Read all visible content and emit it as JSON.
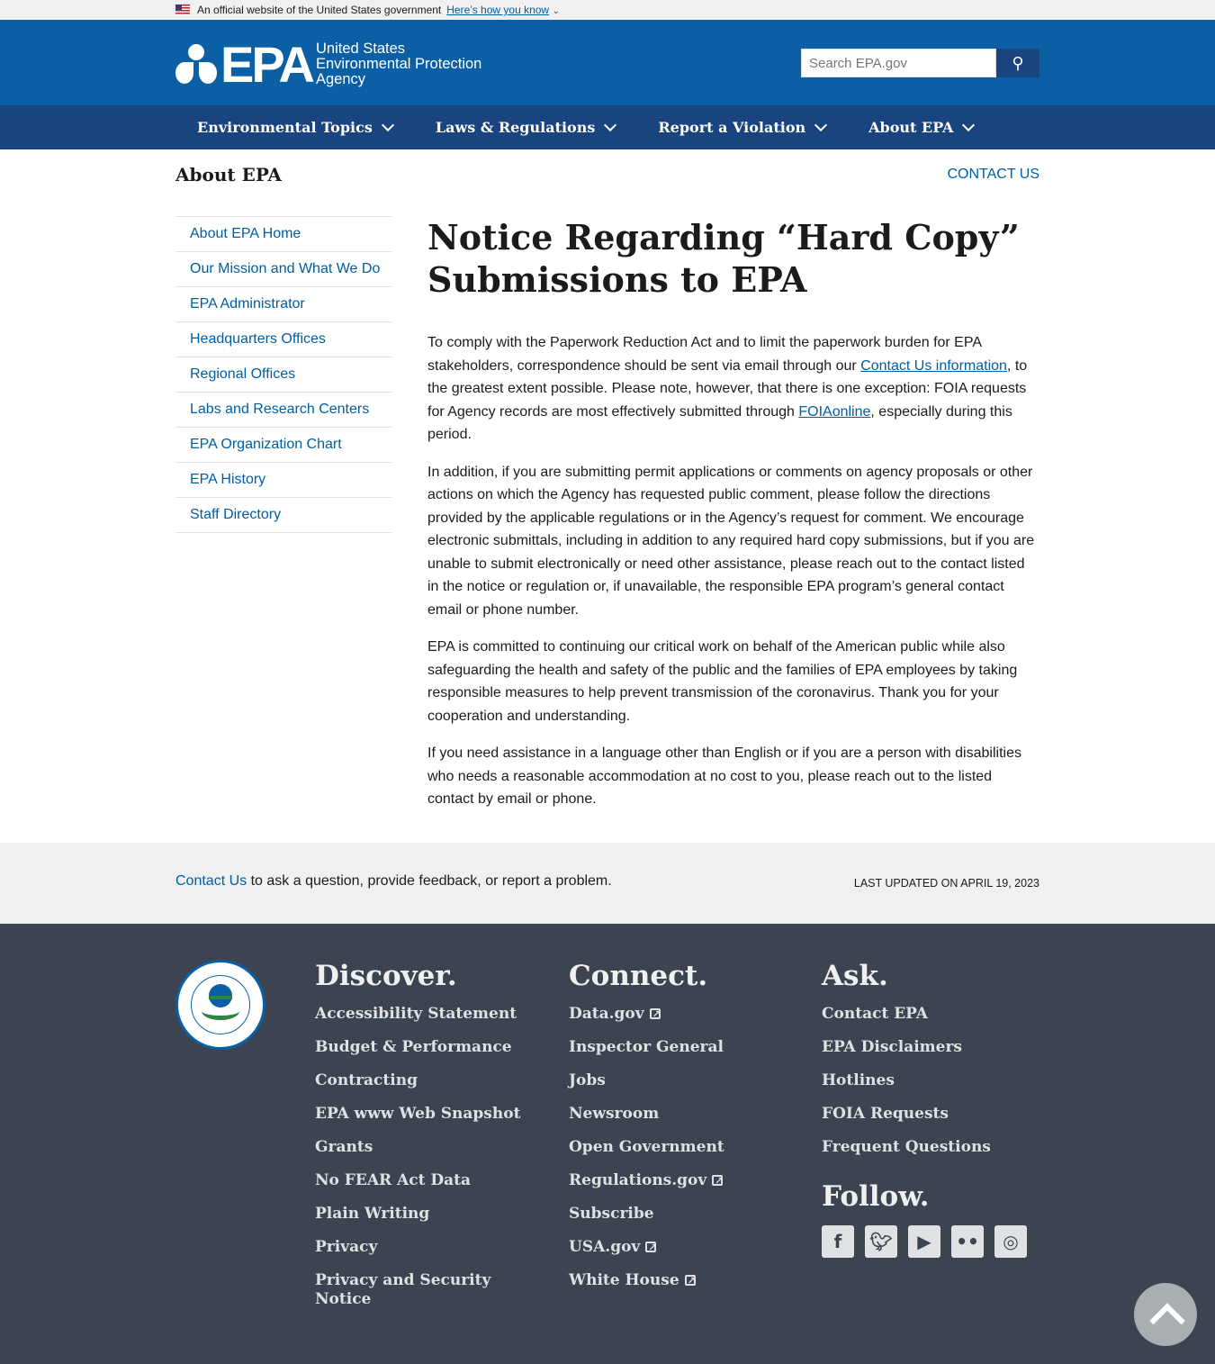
{
  "banner": {
    "text": "An official website of the United States government",
    "link": "Here’s how you know"
  },
  "header": {
    "logo_mark": "EPA",
    "logo_line1": "United States",
    "logo_line2": "Environmental Protection",
    "logo_line3": "Agency",
    "search_placeholder": "Search EPA.gov"
  },
  "nav": [
    "Environmental Topics",
    "Laws & Regulations",
    "Report a Violation",
    "About EPA"
  ],
  "section_title": "About EPA",
  "contact_top": "CONTACT US",
  "sidebar": [
    "About EPA Home",
    "Our Mission and What We Do",
    "EPA Administrator",
    "Headquarters Offices",
    "Regional Offices",
    "Labs and Research Centers",
    "EPA Organization Chart",
    "EPA History",
    "Staff Directory"
  ],
  "main": {
    "title": "Notice Regarding “Hard Copy” Submissions to EPA",
    "p1a": "To comply with the Paperwork Reduction Act and to limit the paperwork burden for EPA stakeholders, correspondence should be sent via email through our ",
    "p1link1": "Contact Us information",
    "p1b": ", to the greatest extent possible. Please note, however, that there is one exception:  FOIA requests for Agency records are most effectively submitted through ",
    "p1link2": "FOIAonline",
    "p1c": ", especially during this period.",
    "p2": "In addition, if you are submitting permit applications or comments on agency proposals or other actions on which the Agency has requested public comment, please follow the directions provided by the applicable regulations or in the Agency’s request for comment.  We encourage electronic submittals, including in addition to any required hard copy submissions, but if you are unable to submit electronically or need other assistance, please reach out to the contact listed in the notice or regulation or, if unavailable, the responsible EPA program’s general contact email or phone number.",
    "p3": "EPA is committed to continuing our critical work on behalf of the American public while also safeguarding the health and safety of the public and the families of EPA employees by taking responsible measures to help prevent transmission of the coronavirus. Thank you for your cooperation and understanding.",
    "p4": "If you need assistance in a language other than English or if you are a person with disabilities who needs a reasonable accommodation at no cost to you, please reach out to the listed contact by email or phone."
  },
  "feedback": {
    "link": "Contact Us",
    "text": " to ask a question, provide feedback, or report a problem.",
    "updated": "Last updated on April 19, 2023"
  },
  "footer": {
    "seal_text": "United States Environmental Protection Agency",
    "discover": {
      "title": "Discover.",
      "links": [
        "Accessibility Statement",
        "Budget & Performance",
        "Contracting",
        "EPA www Web Snapshot",
        "Grants",
        "No FEAR Act Data",
        "Plain Writing",
        "Privacy",
        "Privacy and Security Notice"
      ]
    },
    "connect": {
      "title": "Connect.",
      "links": [
        "Data.gov",
        "Inspector General",
        "Jobs",
        "Newsroom",
        "Open Government",
        "Regulations.gov",
        "Subscribe",
        "USA.gov",
        "White House"
      ]
    },
    "ask": {
      "title": "Ask.",
      "links": [
        "Contact EPA",
        "EPA Disclaimers",
        "Hotlines",
        "FOIA Requests",
        "Frequent Questions"
      ]
    },
    "follow": {
      "title": "Follow.",
      "icons": [
        "facebook-icon",
        "twitter-icon",
        "youtube-icon",
        "flickr-icon",
        "instagram-icon"
      ]
    }
  },
  "colors": {
    "header": "#0b60a5",
    "nav": "#1a4480",
    "footer": "#3d4451",
    "link": "#005ea2"
  }
}
